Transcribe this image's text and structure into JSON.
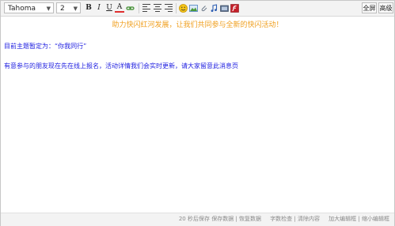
{
  "toolbar": {
    "font_name": "Tahoma",
    "font_size": "2",
    "bold_label": "B",
    "italic_label": "I",
    "underline_label": "U",
    "font_color_label": "A",
    "fullscreen_label": "全屏",
    "advanced_label": "高级"
  },
  "content": {
    "banner": "助力快闪红河发展，让我们共同参与全新的快闪活动！",
    "line1": "目前主题暂定为：“你我同行”",
    "line2": "有意参与的朋友现在先在线上报名，活动详情我们会实时更新，请大家留意此消息页"
  },
  "status": {
    "autosave": "20 秒后保存",
    "save_data": "保存数据",
    "recover_data": "恢复数据",
    "word_check": "字数检查",
    "clear_content": "清除内容",
    "enlarge_editor": "加大编辑框",
    "shrink_editor": "缩小编辑框"
  },
  "colors": {
    "banner": "#f0a020",
    "body_text": "#1d1de0",
    "status_text": "#8a8a8a"
  },
  "icons": [
    "smiley-icon",
    "image-icon",
    "attachment-icon",
    "music-icon",
    "video-icon",
    "flash-icon"
  ]
}
